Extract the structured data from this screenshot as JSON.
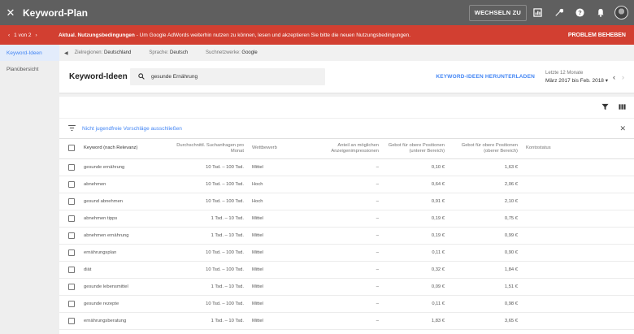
{
  "app": {
    "title": "Keyword-Plan",
    "switch_label": "WECHSELN ZU"
  },
  "alert": {
    "counter": "1 von 2",
    "bold": "Aktual. Nutzungsbedingungen",
    "message": " - Um Google AdWords weiterhin nutzen zu können, lesen und akzeptieren Sie bitte die neuen Nutzungsbedingungen.",
    "action": "PROBLEM BEHEBEN"
  },
  "sidebar": {
    "items": [
      {
        "label": "Keyword-Ideen"
      },
      {
        "label": "Planübersicht"
      }
    ]
  },
  "filters": {
    "region_label": "Zielregionen:",
    "region_value": "Deutschland",
    "language_label": "Sprache:",
    "language_value": "Deutsch",
    "network_label": "Suchnetzwerke:",
    "network_value": "Google"
  },
  "header": {
    "title": "Keyword-Ideen",
    "search_value": "gesunde Ernährung",
    "download": "KEYWORD-IDEEN HERUNTERLADEN",
    "range_label": "Letzte 12 Monate",
    "range_value": "März 2017 bis Feb. 2018"
  },
  "table_tools": {
    "adult_filter": "Nicht jugendfreie Vorschläge ausschließen"
  },
  "table": {
    "headers": {
      "keyword": "Keyword (nach Relevanz)",
      "searches": "Durchschnittl. Suchanfragen pro Monat",
      "competition": "Wettbewerb",
      "impressions": "Anteil an möglichen Anzeigenimpressionen",
      "bid_low": "Gebot für obere Positionen (unterer Bereich)",
      "bid_high": "Gebot für obere Positionen (oberer Bereich)",
      "status": "Kontostatus"
    },
    "rows": [
      {
        "keyword": "gesunde ernährung",
        "searches": "10 Tsd. – 100 Tsd.",
        "competition": "Mittel",
        "impressions": "–",
        "bid_low": "0,10 €",
        "bid_high": "1,63 €"
      },
      {
        "keyword": "abnehmen",
        "searches": "10 Tsd. – 100 Tsd.",
        "competition": "Hoch",
        "impressions": "–",
        "bid_low": "0,64 €",
        "bid_high": "2,06 €"
      },
      {
        "keyword": "gesund abnehmen",
        "searches": "10 Tsd. – 100 Tsd.",
        "competition": "Hoch",
        "impressions": "–",
        "bid_low": "0,91 €",
        "bid_high": "2,10 €"
      },
      {
        "keyword": "abnehmen tipps",
        "searches": "1 Tsd. – 10 Tsd.",
        "competition": "Mittel",
        "impressions": "–",
        "bid_low": "0,19 €",
        "bid_high": "0,75 €"
      },
      {
        "keyword": "abnehmen ernährung",
        "searches": "1 Tsd. – 10 Tsd.",
        "competition": "Mittel",
        "impressions": "–",
        "bid_low": "0,19 €",
        "bid_high": "0,99 €"
      },
      {
        "keyword": "ernährungsplan",
        "searches": "10 Tsd. – 100 Tsd.",
        "competition": "Mittel",
        "impressions": "–",
        "bid_low": "0,11 €",
        "bid_high": "0,90 €"
      },
      {
        "keyword": "diät",
        "searches": "10 Tsd. – 100 Tsd.",
        "competition": "Mittel",
        "impressions": "–",
        "bid_low": "0,32 €",
        "bid_high": "1,84 €"
      },
      {
        "keyword": "gesunde lebensmittel",
        "searches": "1 Tsd. – 10 Tsd.",
        "competition": "Mittel",
        "impressions": "–",
        "bid_low": "0,09 €",
        "bid_high": "1,51 €"
      },
      {
        "keyword": "gesunde rezepte",
        "searches": "10 Tsd. – 100 Tsd.",
        "competition": "Mittel",
        "impressions": "–",
        "bid_low": "0,11 €",
        "bid_high": "0,98 €"
      },
      {
        "keyword": "ernährungsberatung",
        "searches": "1 Tsd. – 10 Tsd.",
        "competition": "Mittel",
        "impressions": "–",
        "bid_low": "1,83 €",
        "bid_high": "3,65 €"
      }
    ]
  },
  "colors": {
    "topbar": "#5f5f5f",
    "alert": "#d23f31",
    "accent": "#4285f4"
  }
}
